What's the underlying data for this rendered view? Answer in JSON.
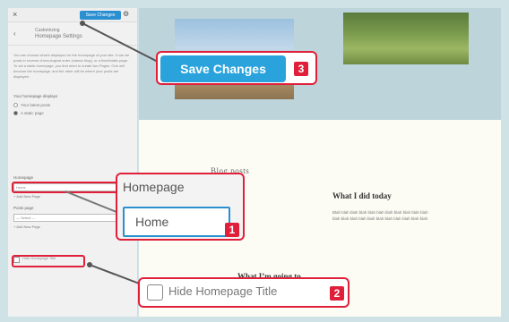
{
  "sidebar": {
    "close_icon": "×",
    "save_label": "Save Changes",
    "gear_icon": "⚙",
    "back_icon": "‹",
    "breadcrumb": "Customizing",
    "title": "Homepage Settings",
    "description": "You can choose what’s displayed on the homepage of your site. It can be posts in reverse chronological order (classic blog), or a fixed/static page. To set a static homepage, you first need to create two Pages. One will become the homepage, and the other will be where your posts are displayed.",
    "radio_group_label": "Your homepage displays",
    "radio_options": [
      "Your latest posts",
      "A static page"
    ],
    "radio_selected_index": 1,
    "homepage_label": "Homepage",
    "homepage_value": "Home",
    "homepage_add": "+ Add New Page",
    "posts_label": "Posts page",
    "posts_value": "— Select —",
    "posts_add": "+ Add New Page",
    "hide_title_text": "Hide Homepage Title"
  },
  "preview": {
    "posts_heading": "Blog posts",
    "post1_title": "What I did today",
    "post1_excerpt": "Blah blah blah blah blah blah blah blah blah blah blah blah blah blah blah blah blah blah blah blah blah blah",
    "post2_title": "What I’m going to"
  },
  "callouts": {
    "save_button_label": "Save Changes",
    "save_number": "3",
    "homepage_label": "Homepage",
    "homepage_value": "Home",
    "homepage_number": "1",
    "hide_title_label": "Hide Homepage Title",
    "hide_title_number": "2"
  },
  "colors": {
    "accent_red": "#e0203b",
    "button_blue": "#2aa3dc",
    "background": "#cfe3e6"
  }
}
